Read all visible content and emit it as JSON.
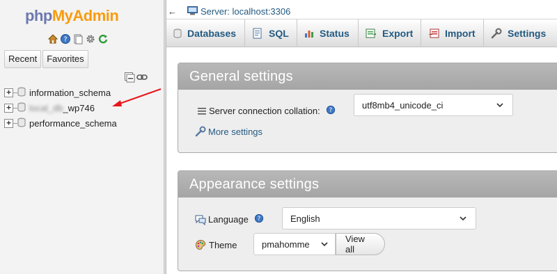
{
  "nav": {
    "logo_part1": "php",
    "logo_part2": "MyAdmin",
    "icons": [
      "home-icon",
      "help-icon",
      "docs-icon",
      "gear-icon",
      "reload-icon"
    ],
    "tabs": [
      {
        "label": "Recent"
      },
      {
        "label": "Favorites"
      }
    ],
    "tree_tools": [
      "collapse-all-icon",
      "link-icon"
    ],
    "databases": [
      {
        "name": "information_schema"
      },
      {
        "name_prefix": "local_db",
        "name_suffix": "_wp746",
        "blurred": true
      },
      {
        "name": "performance_schema"
      }
    ]
  },
  "topbar": {
    "back_arrow": "←",
    "server_label": "Server: localhost:3306"
  },
  "tabs": [
    {
      "label": "Databases",
      "icon": "database-icon"
    },
    {
      "label": "SQL",
      "icon": "sql-icon"
    },
    {
      "label": "Status",
      "icon": "status-icon"
    },
    {
      "label": "Export",
      "icon": "export-icon"
    },
    {
      "label": "Import",
      "icon": "import-icon"
    },
    {
      "label": "Settings",
      "icon": "wrench-icon"
    }
  ],
  "general_settings": {
    "title": "General settings",
    "collation_label": "Server connection collation:",
    "collation_value": "utf8mb4_unicode_ci",
    "more_settings": "More settings"
  },
  "appearance_settings": {
    "title": "Appearance settings",
    "language_label": "Language",
    "language_value": "English",
    "theme_label": "Theme",
    "theme_value": "pmahomme",
    "view_all": "View all"
  },
  "colors": {
    "link": "#235a81",
    "logo_php": "#6c78af",
    "logo_admin": "#f89c0e",
    "annotation_arrow": "#e8151b"
  }
}
